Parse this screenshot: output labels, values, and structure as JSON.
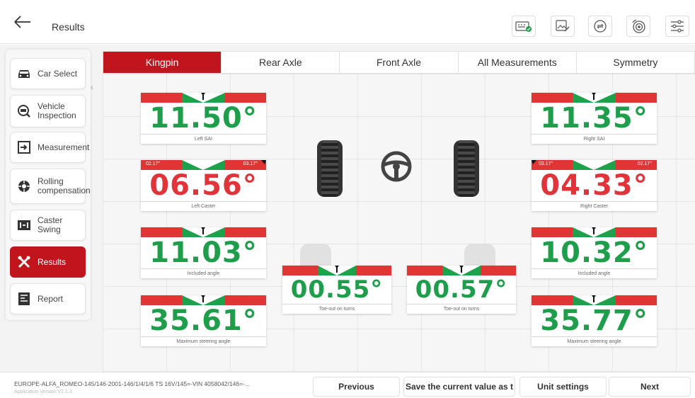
{
  "header": {
    "title": "Results",
    "tools": [
      "keyboard-check-icon",
      "edit-image-icon",
      "sync-steering-icon",
      "wheel-target-icon",
      "settings-sliders-icon"
    ]
  },
  "sidebar": {
    "items": [
      {
        "label": "Car Select",
        "icon": "car-icon",
        "active": false
      },
      {
        "label": "Vehicle Inspection",
        "icon": "inspection-icon",
        "active": false
      },
      {
        "label": "Measurement",
        "icon": "measurement-icon",
        "active": false
      },
      {
        "label": "Rolling compensation",
        "icon": "rolling-wheel-icon",
        "active": false
      },
      {
        "label": "Caster Swing",
        "icon": "caster-swing-icon",
        "active": false
      },
      {
        "label": "Results",
        "icon": "tools-icon",
        "active": true
      },
      {
        "label": "Report",
        "icon": "report-icon",
        "active": false
      }
    ]
  },
  "tabs": [
    {
      "label": "Kingpin",
      "active": true
    },
    {
      "label": "Rear Axle",
      "active": false
    },
    {
      "label": "Front Axle",
      "active": false
    },
    {
      "label": "All Measurements",
      "active": false
    },
    {
      "label": "Symmetry",
      "active": false
    }
  ],
  "gauges": {
    "left_sai": {
      "value": "11.50°",
      "label": "Left SAI",
      "status": "green"
    },
    "right_sai": {
      "value": "11.35°",
      "label": "Right SAI",
      "status": "green"
    },
    "left_caster": {
      "value": "06.56°",
      "label": "Left Caster",
      "status": "red",
      "tol_left": "02.17°",
      "tol_right": "03.17°"
    },
    "right_caster": {
      "value": "04.33°",
      "label": "Right Caster",
      "status": "red",
      "tol_left": "03.17°",
      "tol_right": "02.17°"
    },
    "left_included": {
      "value": "11.03°",
      "label": "Included angle",
      "status": "green"
    },
    "right_included": {
      "value": "10.32°",
      "label": "Included angle",
      "status": "green"
    },
    "left_toe_turns": {
      "value": "00.55°",
      "label": "Toe-out on turns",
      "status": "green"
    },
    "right_toe_turns": {
      "value": "00.57°",
      "label": "Toe-out on turns",
      "status": "green"
    },
    "left_max_steer": {
      "value": "35.61°",
      "label": "Maximum steering angle",
      "status": "green"
    },
    "right_max_steer": {
      "value": "35.77°",
      "label": "Maximum steering angle",
      "status": "green"
    }
  },
  "footer": {
    "vehicle": "EUROPE-ALFA_ROMEO-145/146-2001-146/1/4/1/6 TS 16V/145=-VIN 4058042/146=-...",
    "app_version": "Application Version:V2.1.3",
    "previous_label": "Previous",
    "save_label": "Save the current value as t",
    "unit_label": "Unit settings",
    "next_label": "Next"
  },
  "colors": {
    "accent": "#c0151c",
    "good": "#1e9e4a",
    "bad": "#e0343a"
  }
}
